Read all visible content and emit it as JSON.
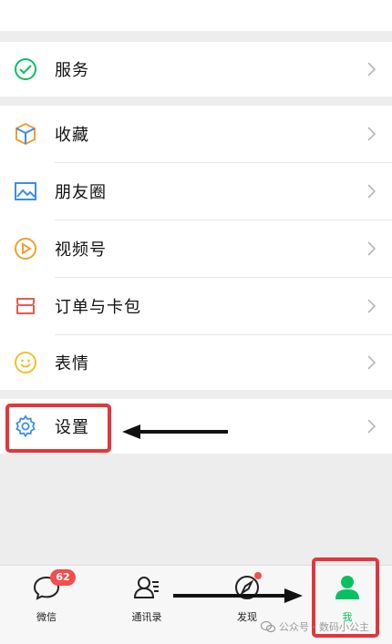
{
  "menu": {
    "service_label": "服务",
    "favorites_label": "收藏",
    "moments_label": "朋友圈",
    "channels_label": "视频号",
    "orders_label": "订单与卡包",
    "stickers_label": "表情",
    "settings_label": "设置"
  },
  "tabbar": {
    "chats_label": "微信",
    "chats_badge": "62",
    "contacts_label": "通讯录",
    "discover_label": "发现",
    "me_label": "我"
  },
  "watermark": {
    "prefix": "公众号 · ",
    "name": "数码小公主"
  },
  "colors": {
    "accent": "#07c160",
    "highlight_box": "#e3363c",
    "badge": "#f44d4d"
  }
}
